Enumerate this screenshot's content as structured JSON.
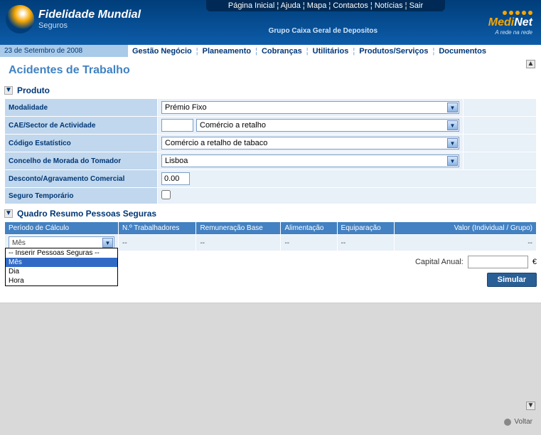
{
  "brand": {
    "title": "Fidelidade Mundial",
    "subtitle": "Seguros"
  },
  "topnav": {
    "pagina": "Página Inicial",
    "ajuda": "Ajuda",
    "mapa": "Mapa",
    "contactos": "Contactos",
    "noticias": "Notícias",
    "sair": "Sair"
  },
  "header": {
    "grupo": "Grupo Caixa Geral de Depositos",
    "medinet1": "Medi",
    "medinet2": "Net",
    "medinet_tag": "A rede na rede"
  },
  "date": "23 de Setembro de 2008",
  "mainnav": {
    "gestao": "Gestão Negócio",
    "planeamento": "Planeamento",
    "cobrancas": "Cobranças",
    "utilitarios": "Utilitários",
    "produtos": "Produtos/Serviços",
    "documentos": "Documentos"
  },
  "page": {
    "title": "Acidentes de Trabalho"
  },
  "sections": {
    "produto": "Produto",
    "quadro": "Quadro Resumo Pessoas Seguras"
  },
  "form": {
    "modalidade_label": "Modalidade",
    "modalidade_value": "Prémio Fixo",
    "cae_label": "CAE/Sector de Actividade",
    "cae_input": "",
    "cae_value": "Comércio a retalho",
    "codigo_label": "Código Estatístico",
    "codigo_value": "Comércio a retalho de tabaco",
    "concelho_label": "Concelho de Morada do Tomador",
    "concelho_value": "Lisboa",
    "desconto_label": "Desconto/Agravamento Comercial",
    "desconto_value": "0.00",
    "seguro_label": "Seguro Temporário"
  },
  "grid": {
    "col1": "Período de Cálculo",
    "col2": "N.º Trabalhadores",
    "col3": "Remuneração Base",
    "col4": "Alimentação",
    "col5": "Equiparação",
    "col6": "Valor (Individual / Grupo)",
    "periodo_value": "Mês",
    "dash": "--",
    "opt_header": "-- Inserir Pessoas Seguras --",
    "opt_mes": "Mês",
    "opt_dia": "Dia",
    "opt_hora": "Hora"
  },
  "footer": {
    "capital_label": "Capital Anual:",
    "capital_value": "",
    "euro": "€",
    "simular": "Simular",
    "voltar": "Voltar"
  },
  "arrows": {
    "up": "▲",
    "down": "▼"
  }
}
